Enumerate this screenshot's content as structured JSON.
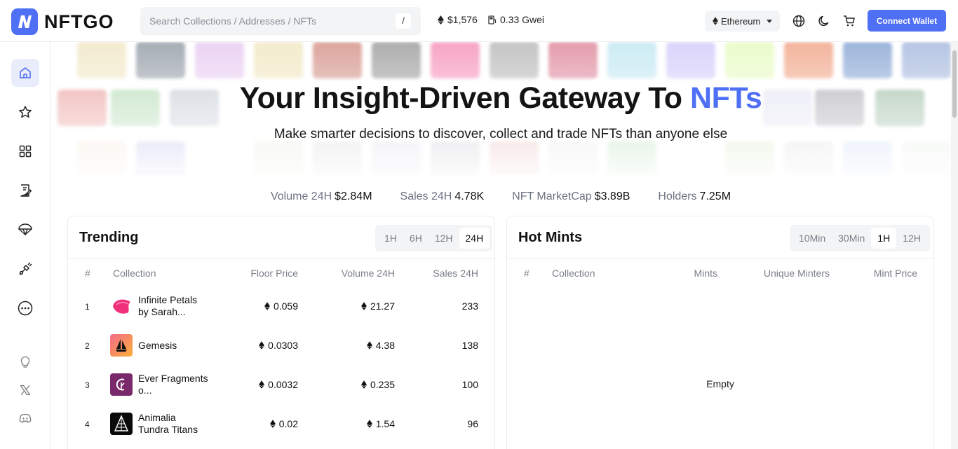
{
  "header": {
    "brand": "NFTGO",
    "search_placeholder": "Search Collections / Addresses / NFTs",
    "search_shortcut": "/",
    "eth_price": "$1,576",
    "gas": "0.33 Gwei",
    "chain": "Ethereum",
    "connect_label": "Connect Wallet"
  },
  "hero": {
    "title_main": "Your Insight-Driven Gateway To ",
    "title_accent": "NFTs",
    "subtitle": "Make smarter decisions to discover, collect and trade NFTs than anyone else"
  },
  "stats": [
    {
      "label": "Volume 24H",
      "value": "$2.84M"
    },
    {
      "label": "Sales 24H",
      "value": "4.78K"
    },
    {
      "label": "NFT MarketCap",
      "value": "$3.89B"
    },
    {
      "label": "Holders",
      "value": "7.25M"
    }
  ],
  "trending": {
    "title": "Trending",
    "ranges": [
      "1H",
      "6H",
      "12H",
      "24H"
    ],
    "selected_range": "24H",
    "columns": {
      "rank": "#",
      "collection": "Collection",
      "floor": "Floor Price",
      "volume": "Volume 24H",
      "sales": "Sales 24H"
    },
    "rows": [
      {
        "rank": "1",
        "name": "Infinite Petals by Sarah...",
        "floor": "0.059",
        "volume": "21.27",
        "sales": "233"
      },
      {
        "rank": "2",
        "name": "Gemesis",
        "floor": "0.0303",
        "volume": "4.38",
        "sales": "138"
      },
      {
        "rank": "3",
        "name": "Ever Fragments o...",
        "floor": "0.0032",
        "volume": "0.235",
        "sales": "100"
      },
      {
        "rank": "4",
        "name": "Animalia Tundra Titans",
        "floor": "0.02",
        "volume": "1.54",
        "sales": "96"
      }
    ]
  },
  "hot_mints": {
    "title": "Hot Mints",
    "ranges": [
      "10Min",
      "30Min",
      "1H",
      "12H"
    ],
    "selected_range": "1H",
    "columns": {
      "rank": "#",
      "collection": "Collection",
      "mints": "Mints",
      "minters": "Unique Minters",
      "price": "Mint Price"
    },
    "empty_text": "Empty"
  },
  "colors": {
    "accent": "#4f6ff5",
    "active_nav_bg": "#e9edfb"
  },
  "sidebar_icons": [
    "home-icon",
    "star-icon",
    "grid-icon",
    "report-icon",
    "parachute-icon",
    "plug-icon",
    "more-icon",
    "bulb-icon",
    "x-icon",
    "discord-icon"
  ]
}
